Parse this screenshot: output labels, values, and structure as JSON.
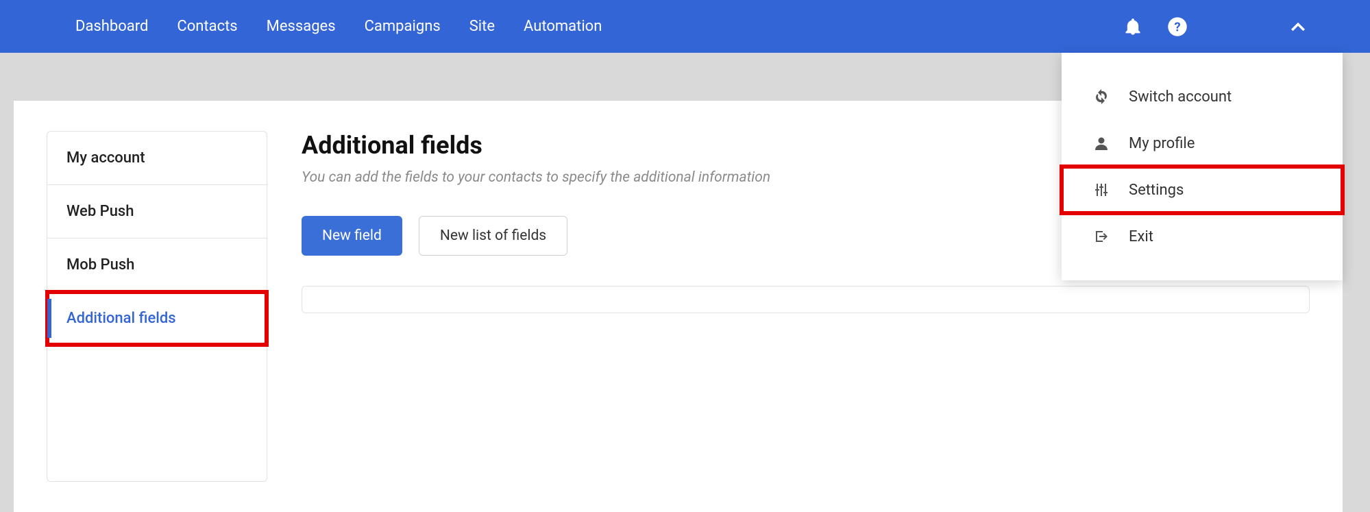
{
  "nav": {
    "items": [
      {
        "label": "Dashboard"
      },
      {
        "label": "Contacts"
      },
      {
        "label": "Messages"
      },
      {
        "label": "Campaigns"
      },
      {
        "label": "Site"
      },
      {
        "label": "Automation"
      }
    ]
  },
  "sidebar": {
    "items": [
      {
        "label": "My account"
      },
      {
        "label": "Web Push"
      },
      {
        "label": "Mob Push"
      },
      {
        "label": "Additional fields"
      }
    ]
  },
  "main": {
    "title": "Additional fields",
    "description": "You can add the fields to your contacts to specify the additional information",
    "new_field_label": "New field",
    "new_list_label": "New list of fields"
  },
  "dropdown": {
    "items": [
      {
        "label": "Switch account"
      },
      {
        "label": "My profile"
      },
      {
        "label": "Settings"
      },
      {
        "label": "Exit"
      }
    ]
  }
}
